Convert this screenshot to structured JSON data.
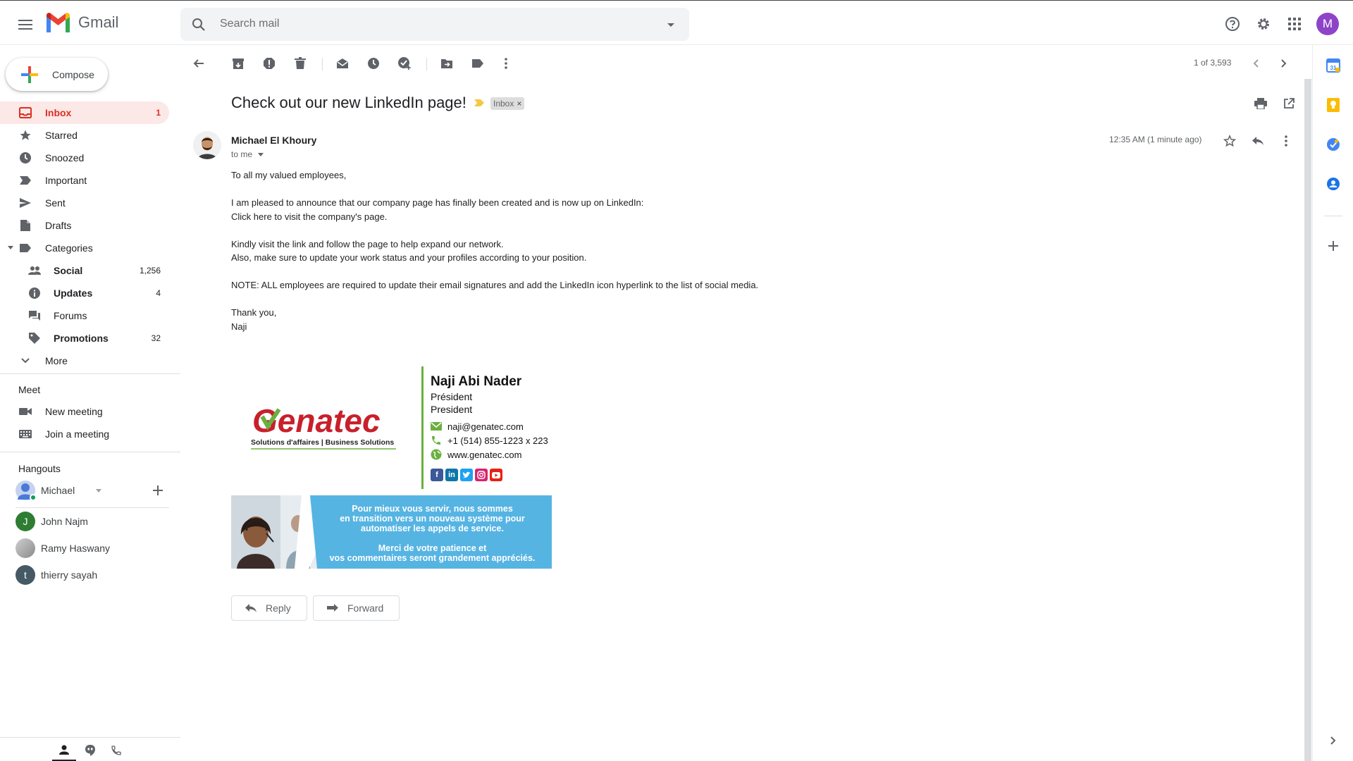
{
  "app": {
    "name": "Gmail"
  },
  "search": {
    "placeholder": "Search mail"
  },
  "user": {
    "initial": "M",
    "color": "#8e44c9"
  },
  "compose": {
    "label": "Compose"
  },
  "nav": {
    "inbox": {
      "label": "Inbox",
      "count": "1"
    },
    "starred": {
      "label": "Starred"
    },
    "snoozed": {
      "label": "Snoozed"
    },
    "important": {
      "label": "Important"
    },
    "sent": {
      "label": "Sent"
    },
    "drafts": {
      "label": "Drafts"
    },
    "categories": {
      "label": "Categories"
    },
    "social": {
      "label": "Social",
      "count": "1,256"
    },
    "updates": {
      "label": "Updates",
      "count": "4"
    },
    "forums": {
      "label": "Forums"
    },
    "promotions": {
      "label": "Promotions",
      "count": "32"
    },
    "more": {
      "label": "More"
    }
  },
  "meet": {
    "title": "Meet",
    "new_meeting": "New meeting",
    "join_meeting": "Join a meeting"
  },
  "hangouts": {
    "title": "Hangouts",
    "me": "Michael",
    "contacts": [
      {
        "name": "John Najm",
        "initial": "J",
        "color": "#2e7d32"
      },
      {
        "name": "Ramy Haswany",
        "initial": "",
        "color": "#9e9e9e"
      },
      {
        "name": "thierry sayah",
        "initial": "t",
        "color": "#455a64"
      }
    ]
  },
  "toolbar": {
    "pager": "1 of 3,593"
  },
  "message": {
    "subject": "Check out our new LinkedIn page!",
    "label_chip": "Inbox",
    "sender": "Michael El Khoury",
    "to": "to me",
    "time": "12:35 AM (1 minute ago)",
    "body": {
      "greeting": "To all my valued employees,",
      "announce_1": "I am pleased to announce that our company page has finally been created and is now up on LinkedIn:",
      "announce_2": "Click here to visit the company's page.",
      "kindly_1": "Kindly visit the link and follow the page to help expand our network.",
      "kindly_2": "Also, make sure to update your work status and your profiles according to your position.",
      "note": "NOTE: ALL employees are required to update their email signatures and add the LinkedIn icon hyperlink to the list of social media.",
      "thanks": "Thank you,",
      "sign": "Naji"
    },
    "signature": {
      "logo_text": "Genatec",
      "logo_sub": "Solutions d'affaires | Business Solutions",
      "name": "Naji Abi Nader",
      "title_fr": "Président",
      "title_en": "President",
      "email": "naji@genatec.com",
      "phone": "+1 (514) 855-1223 x 223",
      "web": "www.genatec.com",
      "accent": "#6ab03f",
      "banner_line1": "Pour mieux vous servir, nous sommes",
      "banner_line2": "en transition vers un nouveau système pour",
      "banner_line3": "automatiser les appels de service.",
      "banner_line4": "Merci de votre patience et",
      "banner_line5": "vos commentaires seront grandement appréciés."
    },
    "actions": {
      "reply": "Reply",
      "forward": "Forward"
    }
  }
}
